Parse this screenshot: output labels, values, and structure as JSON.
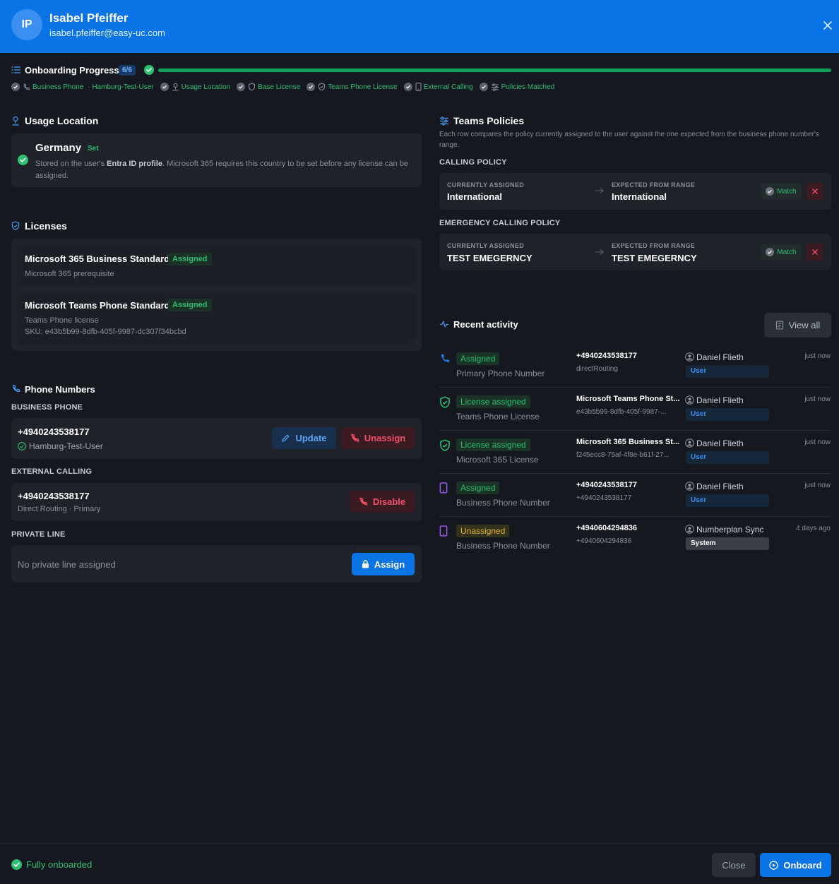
{
  "header": {
    "avatar_initials": "IP",
    "name": "Isabel Pfeiffer",
    "email": "isabel.pfeiffer@easy-uc.com"
  },
  "progress": {
    "title": "Onboarding Progress",
    "badge": "6/6",
    "completion": 1.0,
    "steps": [
      {
        "label": "Business Phone",
        "icon": "phone-icon"
      },
      {
        "label": "· Hamburg-Test-User",
        "icon": ""
      },
      {
        "label": "Usage Location",
        "icon": "location-icon"
      },
      {
        "label": "Base License",
        "icon": "shield-icon"
      },
      {
        "label": "Teams Phone License",
        "icon": "shield-check-icon"
      },
      {
        "label": "External Calling",
        "icon": "mobile-icon"
      },
      {
        "label": "Policies Matched",
        "icon": "sliders-icon"
      }
    ]
  },
  "usage_location": {
    "title": "Usage Location",
    "country": "Germany",
    "status": "Set",
    "desc_prefix": "Stored on the user's ",
    "desc_bold": "Entra ID profile",
    "desc_suffix": ". Microsoft 365 requires this country to be set before any license can be assigned."
  },
  "licenses": {
    "title": "Licenses",
    "items": [
      {
        "name": "Microsoft 365 Business Standard",
        "status": "Assigned",
        "line1": "Microsoft 365 prerequisite",
        "line2": ""
      },
      {
        "name": "Microsoft Teams Phone Standard",
        "status": "Assigned",
        "line1": "Teams Phone license",
        "line2": "SKU: e43b5b99-8dfb-405f-9987-dc307f34bcbd"
      }
    ]
  },
  "phone_numbers": {
    "title": "Phone Numbers",
    "business_caption": "BUSINESS PHONE",
    "business_number": "+4940243538177",
    "business_user": "Hamburg-Test-User",
    "update_label": "Update",
    "unassign_label": "Unassign",
    "external_caption": "EXTERNAL CALLING",
    "external_number": "+4940243538177",
    "external_detail": "Direct Routing · Primary",
    "disable_label": "Disable",
    "private_caption": "PRIVATE LINE",
    "private_empty": "No private line assigned",
    "assign_label": "Assign"
  },
  "teams_policies": {
    "title": "Teams Policies",
    "desc": "Each row compares the policy currently assigned to the user against the one expected from the business phone number's range.",
    "current_caption": "CURRENTLY ASSIGNED",
    "expected_caption": "EXPECTED FROM RANGE",
    "match_label": "Match",
    "policies": [
      {
        "caption": "CALLING POLICY",
        "current": "International",
        "expected": "International"
      },
      {
        "caption": "EMERGENCY CALLING POLICY",
        "current": "TEST EMEGERNCY",
        "expected": "TEST EMEGERNCY"
      }
    ]
  },
  "activity": {
    "title": "Recent activity",
    "view_all": "View all",
    "rows": [
      {
        "icon": "phone-icon",
        "tag": "Assigned",
        "tag_color": "green",
        "subtitle": "Primary Phone Number",
        "target": "+4940243538177",
        "target_sub": "directRouting",
        "actor": "Daniel Flieth",
        "role": "User",
        "time": "just now"
      },
      {
        "icon": "shield-check-icon",
        "tag": "License assigned",
        "tag_color": "green",
        "subtitle": "Teams Phone License",
        "target": "Microsoft Teams Phone St...",
        "target_sub": "e43b5b99-8dfb-405f-9987-...",
        "actor": "Daniel Flieth",
        "role": "User",
        "time": "just now"
      },
      {
        "icon": "shield-check-icon",
        "tag": "License assigned",
        "tag_color": "green",
        "subtitle": "Microsoft 365 License",
        "target": "Microsoft 365 Business St...",
        "target_sub": "f245ecc8-75af-4f8e-b61f-27...",
        "actor": "Daniel Flieth",
        "role": "User",
        "time": "just now"
      },
      {
        "icon": "mobile-icon",
        "tag": "Assigned",
        "tag_color": "green",
        "subtitle": "Business Phone Number",
        "target": "+4940243538177",
        "target_sub": "+4940243538177",
        "actor": "Daniel Flieth",
        "role": "User",
        "time": "just now"
      },
      {
        "icon": "mobile-icon",
        "tag": "Unassigned",
        "tag_color": "yellow",
        "subtitle": "Business Phone Number",
        "target": "+4940604294836",
        "target_sub": "+4940604294836",
        "actor": "Numberplan Sync",
        "role": "System",
        "time": "4 days ago"
      }
    ]
  },
  "footer": {
    "status": "Fully onboarded",
    "close_label": "Close",
    "onboard_label": "Onboard"
  },
  "colors": {
    "brand": "#0a73e6",
    "success": "#2fbf73",
    "danger": "#f0506b",
    "warning": "#e0b437",
    "background": "#15181e"
  }
}
